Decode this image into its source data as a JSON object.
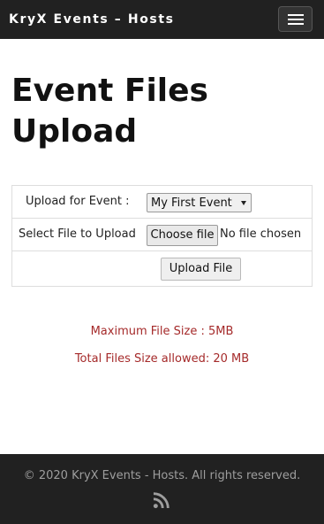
{
  "header": {
    "brand": "KryX Events – Hosts",
    "menu_icon": "hamburger-icon"
  },
  "main": {
    "title": "Event Files Upload",
    "form": {
      "event_label": "Upload for Event :",
      "event_selected": "My First Event",
      "file_label": "Select File to Upload",
      "choose_file_label": "Choose file",
      "file_status": "No file chosen",
      "submit_label": "Upload File"
    },
    "limits": {
      "max_file_size": "Maximum File Size : 5MB",
      "total_size": "Total Files Size allowed: 20 MB"
    }
  },
  "footer": {
    "copyright": "© 2020 KryX Events - Hosts. All rights reserved.",
    "feed_icon": "rss-icon"
  },
  "colors": {
    "navbar_bg": "#212121",
    "limit_text": "#a52a2a",
    "footer_text": "#9e9e9e"
  }
}
